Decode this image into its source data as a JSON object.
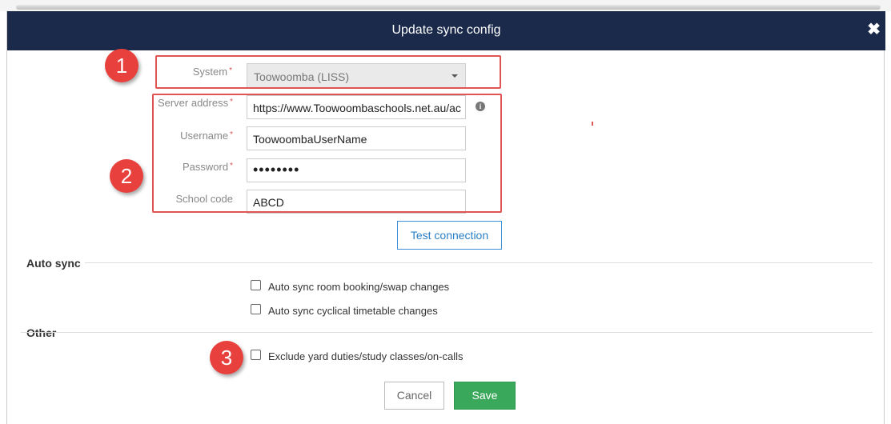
{
  "dialog": {
    "title": "Update sync config",
    "close_icon": "✖"
  },
  "form": {
    "system": {
      "label": "System",
      "required_mark": "*",
      "value": "Toowoomba (LISS)"
    },
    "server_address": {
      "label": "Server address",
      "required_mark": "*",
      "value": "https://www.Toowoombaschools.net.au/ac"
    },
    "username": {
      "label": "Username",
      "required_mark": "*",
      "value": "ToowoombaUserName"
    },
    "password": {
      "label": "Password",
      "required_mark": "*",
      "value": "••••••••"
    },
    "school_code": {
      "label": "School code",
      "value": "ABCD"
    },
    "info_icon": "i",
    "test_connection_label": "Test connection"
  },
  "auto_sync": {
    "title": "Auto sync",
    "options": [
      {
        "label": "Auto sync room booking/swap changes",
        "checked": false
      },
      {
        "label": "Auto sync cyclical timetable changes",
        "checked": false
      }
    ]
  },
  "other": {
    "title": "Other",
    "options": [
      {
        "label": "Exclude yard duties/study classes/on-calls",
        "checked": false
      }
    ]
  },
  "footer": {
    "cancel_label": "Cancel",
    "save_label": "Save"
  },
  "annotations": {
    "badge_1": "1",
    "badge_2": "2",
    "badge_3": "3",
    "highlight_color": "#e05454"
  }
}
